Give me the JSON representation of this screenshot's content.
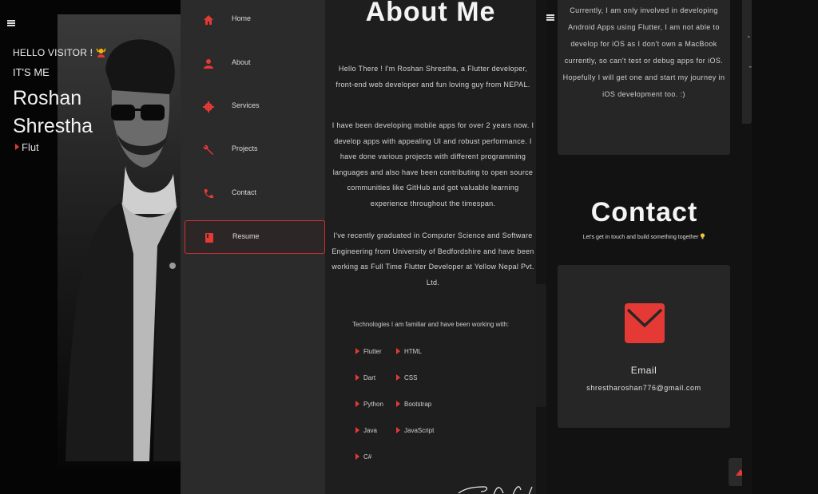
{
  "hero": {
    "greeting": "HELLO VISITOR !",
    "intro": "IT'S ME",
    "name_first": "Roshan",
    "name_last": "Shrestha",
    "typed_text": "Flut"
  },
  "sidebar": {
    "items": [
      {
        "label": "Home",
        "icon": "home-icon"
      },
      {
        "label": "About",
        "icon": "person-icon"
      },
      {
        "label": "Services",
        "icon": "gear-icon"
      },
      {
        "label": "Projects",
        "icon": "wrench-icon"
      },
      {
        "label": "Contact",
        "icon": "phone-icon"
      },
      {
        "label": "Resume",
        "icon": "book-icon"
      }
    ],
    "active": "Resume",
    "accent": "#e53935"
  },
  "about": {
    "title": "About Me",
    "para1": "Hello There ! I'm Roshan Shrestha, a Flutter developer, front-end web developer and fun loving guy from NEPAL.",
    "para2": "I have been developing mobile apps for over 2 years now. I develop apps with appealing UI and robust performance. I have done various projects with different programming languages and also have been contributing to open source communities like GitHub and got valuable learning experience throughout the timespan.",
    "para3": "I've recently graduated in Computer Science and Software Engineering from University of Bedfordshire and have been working as Full Time Flutter Developer at Yellow Nepal Pvt. Ltd.",
    "tech_intro": "Technologies I am familiar and have been working with:",
    "technologies": [
      "Flutter",
      "HTML",
      "Dart",
      "CSS",
      "Python",
      "Bootstrap",
      "Java",
      "JavaScript",
      "C#"
    ]
  },
  "contact": {
    "current_text": "Currently, I am only involved in developing Android Apps using Flutter, I am not able to develop for iOS as I don't own a MacBook currently, so can't test or debug apps for iOS. Hopefully I will get one and start my journey in iOS development too. :)",
    "title": "Contact",
    "subtitle": "Let's get in touch and build something together",
    "email_label": "Email",
    "email_value": "shrestharoshan776@gmail.com"
  },
  "edge": {
    "quote_mark_1": "“",
    "quote_mark_2": "”"
  }
}
